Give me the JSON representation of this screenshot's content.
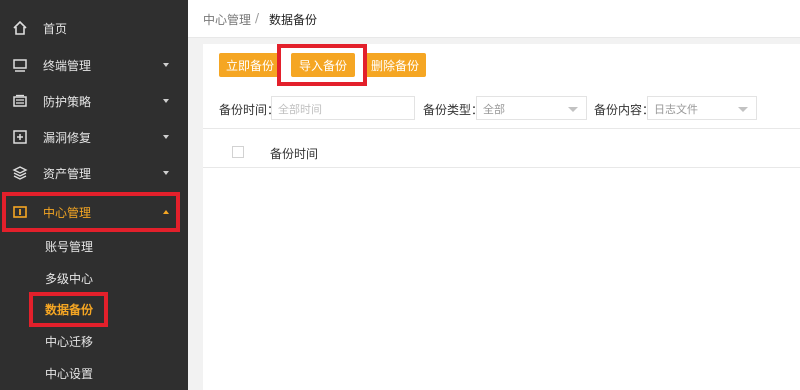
{
  "sidebar": {
    "items": [
      {
        "label": "首页",
        "icon": "home-icon",
        "has_caret": false
      },
      {
        "label": "终端管理",
        "icon": "monitor-icon",
        "has_caret": true
      },
      {
        "label": "防护策略",
        "icon": "strategy-icon",
        "has_caret": true
      },
      {
        "label": "漏洞修复",
        "icon": "plus-box-icon",
        "has_caret": true
      },
      {
        "label": "资产管理",
        "icon": "layers-icon",
        "has_caret": true
      },
      {
        "label": "中心管理",
        "icon": "center-icon",
        "has_caret": true,
        "active": true
      }
    ],
    "sub_items": [
      {
        "label": "账号管理"
      },
      {
        "label": "多级中心"
      },
      {
        "label": "数据备份",
        "active": true
      },
      {
        "label": "中心迁移"
      },
      {
        "label": "中心设置"
      }
    ]
  },
  "breadcrumb": {
    "parent": "中心管理",
    "separator": "/",
    "current": "数据备份"
  },
  "toolbar": {
    "backup_now": "立即备份",
    "import_backup": "导入备份",
    "delete_backup": "删除备份"
  },
  "filters": {
    "time_label": "备份时间：",
    "time_placeholder": "全部时间",
    "type_label": "备份类型：",
    "type_value": "全部",
    "content_label": "备份内容：",
    "content_value": "日志文件"
  },
  "table": {
    "columns": [
      "备份时间"
    ]
  },
  "colors": {
    "accent": "#f5a623",
    "highlight": "#e3202b",
    "sidebar_bg": "#2f2f2f"
  }
}
